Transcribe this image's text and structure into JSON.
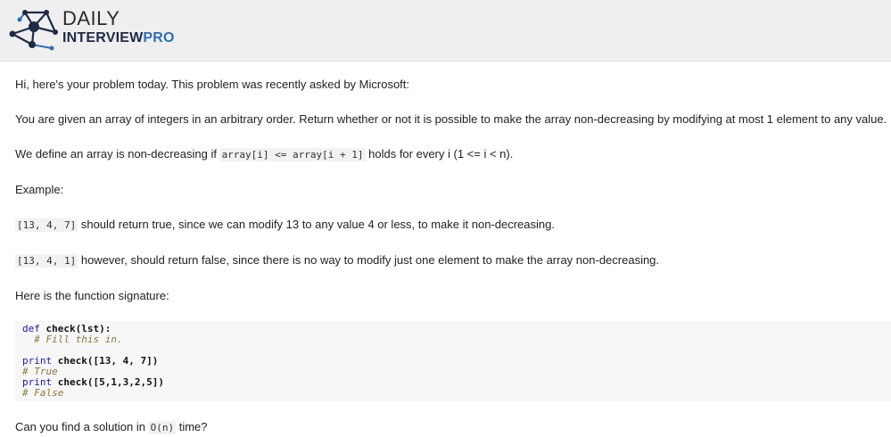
{
  "header": {
    "brand_top": "DAILY",
    "brand_bottom_main": "INTERVIEW",
    "brand_bottom_accent": "PRO",
    "colors": {
      "background": "#efefef",
      "brand_dark": "#1f2a44",
      "brand_accent": "#2f6db5"
    },
    "logo_icon": "network-nodes-icon"
  },
  "body": {
    "intro": "Hi, here's your problem today. This problem was recently asked by Microsoft:",
    "problem": "You are given an array of integers in an arbitrary order. Return whether or not it is possible to make the array non-decreasing by modifying at most 1 element to any value.",
    "definition_pre": "We define an array is non-decreasing if ",
    "definition_code": "array[i] <= array[i + 1]",
    "definition_post": " holds for every i (1 <= i < n).",
    "example_label": "Example:",
    "example1_code": "[13, 4, 7]",
    "example1_text": " should return true, since we can modify 13 to any value 4 or less, to make it non-decreasing.",
    "example2_code": "[13, 4, 1]",
    "example2_text": " however, should return false, since there is no way to modify just one element to make the array non-decreasing.",
    "signature_label": "Here is the function signature:",
    "code": {
      "l1_kw": "def",
      "l1_rest": " check(lst):",
      "l2": "  # Fill this in.",
      "l4_kw": "print",
      "l4_rest": " check([13, 4, 7])",
      "l5": "# True",
      "l6_kw": "print",
      "l6_rest": " check([5,1,3,2,5])",
      "l7": "# False"
    },
    "question_pre": "Can you find a solution in ",
    "question_code": "O(n)",
    "question_post": " time?"
  }
}
